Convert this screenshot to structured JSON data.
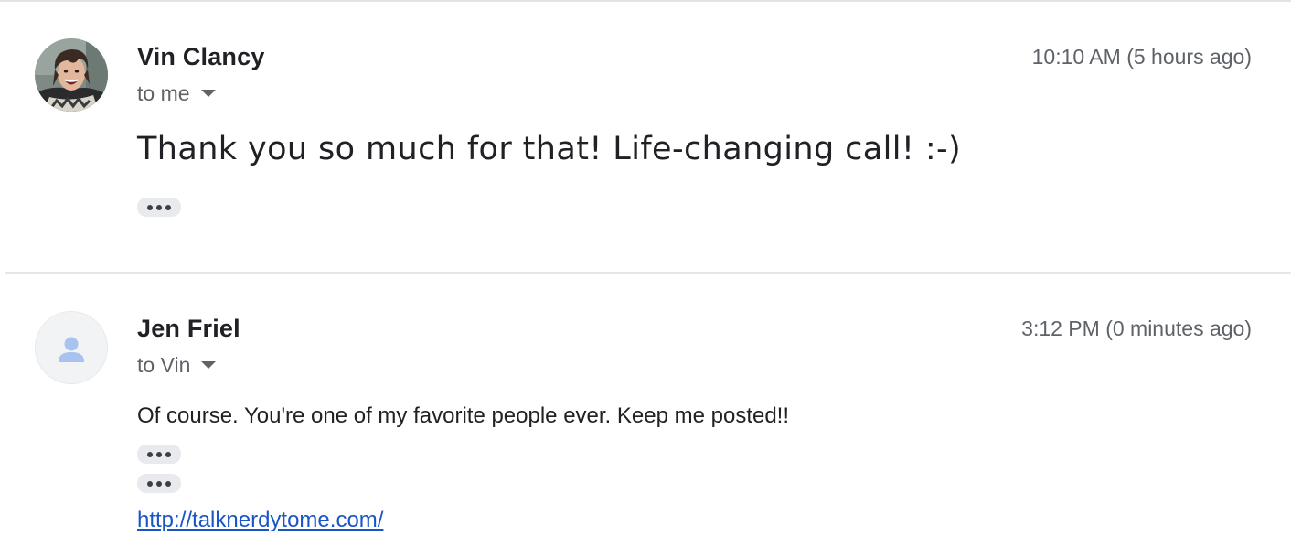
{
  "thread": {
    "messages": [
      {
        "sender": "Vin Clancy",
        "recipient": "to me",
        "time": "10:10 AM (5 hours ago)",
        "body": "Thank you so much for that! Life-changing call! :-)",
        "avatar": "photo-avatar"
      },
      {
        "sender": "Jen Friel",
        "recipient": "to Vin",
        "time": "3:12 PM (0 minutes ago)",
        "body": "Of course. You're one of my favorite people ever. Keep me posted!!",
        "link": "http://talknerdytome.com/",
        "avatar": "person-placeholder-icon"
      }
    ]
  },
  "icons": {
    "recipient_toggle": "caret-down-icon",
    "trimmed_content": "more-horiz-icon"
  },
  "colors": {
    "link": "#1a55c7",
    "placeholder_avatar_bg": "#f1f3f4",
    "placeholder_person": "#a8c3ef",
    "secondary_text": "#5f6368"
  }
}
